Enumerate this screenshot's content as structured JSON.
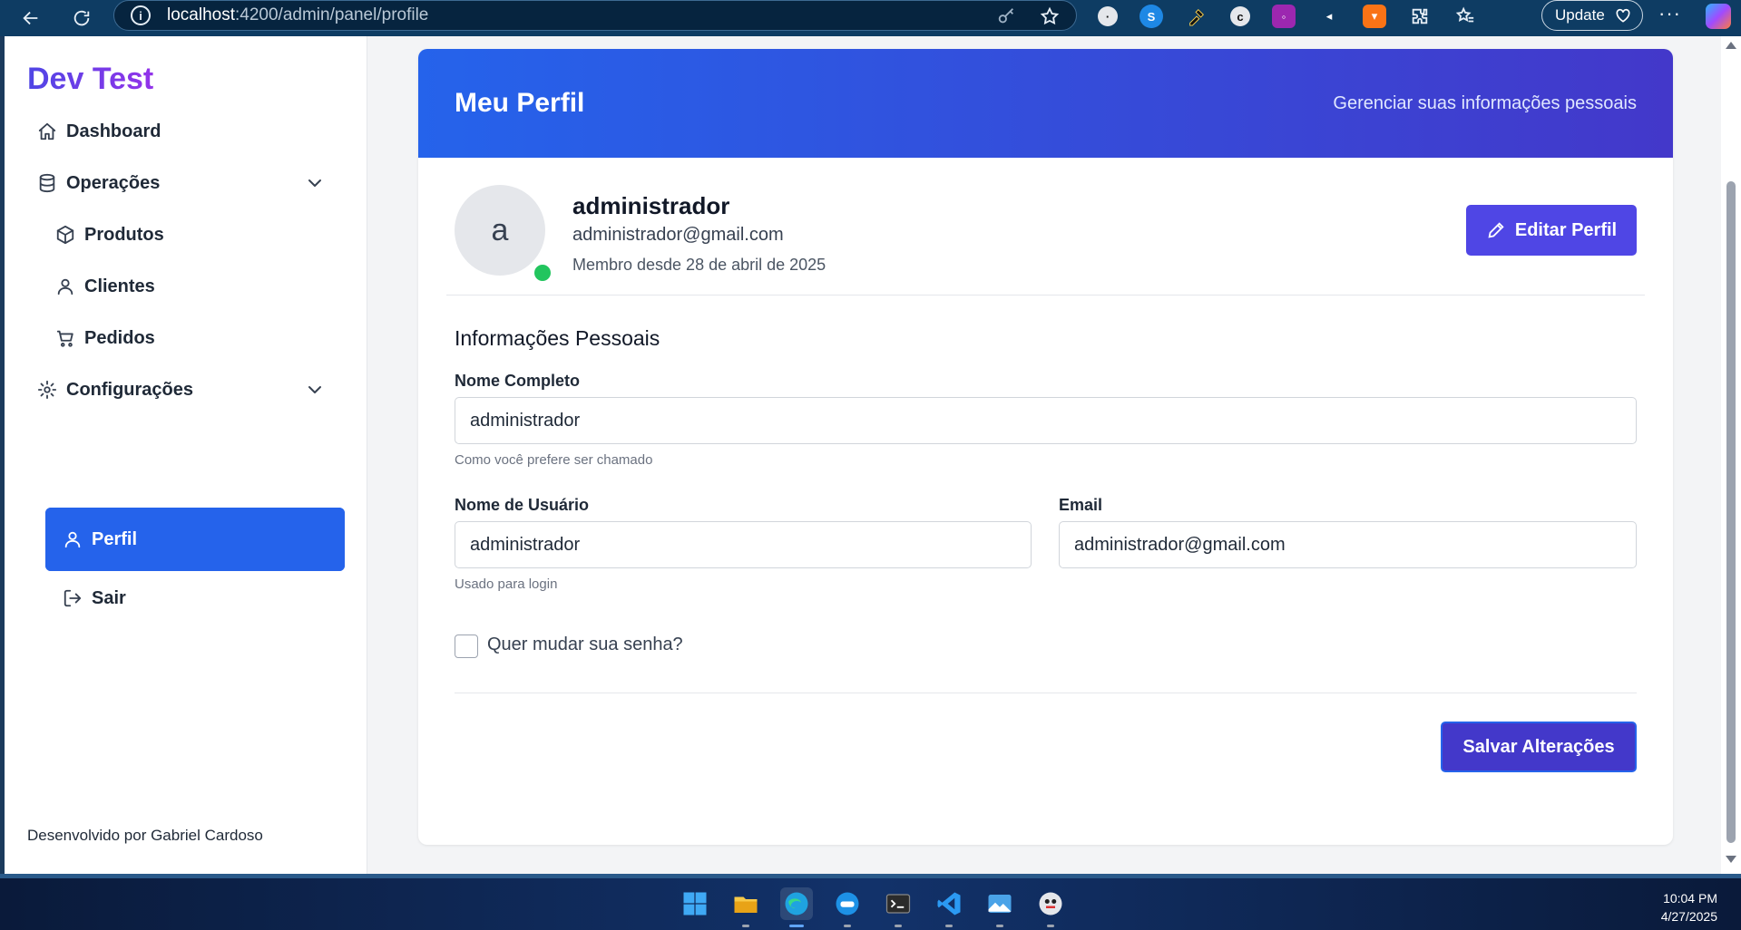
{
  "browser": {
    "url_host": "localhost",
    "url_path": ":4200/admin/panel/profile",
    "update_label": "Update"
  },
  "sidebar": {
    "brand": "Dev Test",
    "items": [
      {
        "label": "Dashboard",
        "icon": "home-icon"
      },
      {
        "label": "Operações",
        "icon": "database-icon"
      },
      {
        "label": "Produtos",
        "icon": "box-icon"
      },
      {
        "label": "Clientes",
        "icon": "user-icon"
      },
      {
        "label": "Pedidos",
        "icon": "cart-icon"
      },
      {
        "label": "Configurações",
        "icon": "gear-icon"
      },
      {
        "label": "Perfil",
        "icon": "user-icon"
      },
      {
        "label": "Sair",
        "icon": "logout-icon"
      }
    ],
    "footer": "Desenvolvido por Gabriel Cardoso"
  },
  "header": {
    "title": "Meu Perfil",
    "subtitle": "Gerenciar suas informações pessoais"
  },
  "profile": {
    "avatar_letter": "a",
    "name": "administrador",
    "email": "administrador@gmail.com",
    "member_since": "Membro desde 28 de abril de 2025",
    "edit_label": "Editar Perfil"
  },
  "form": {
    "section_title": "Informações Pessoais",
    "full_name_label": "Nome Completo",
    "full_name_value": "administrador",
    "full_name_hint": "Como você prefere ser chamado",
    "username_label": "Nome de Usuário",
    "username_value": "administrador",
    "username_hint": "Usado para login",
    "email_label": "Email",
    "email_value": "administrador@gmail.com",
    "change_password_label": "Quer mudar sua senha?",
    "save_label": "Salvar Alterações"
  },
  "taskbar": {
    "time": "10:04 PM",
    "date": "4/27/2025"
  },
  "colors": {
    "primary": "#2563eb",
    "indigo": "#4f46e5",
    "online": "#22c55e"
  }
}
